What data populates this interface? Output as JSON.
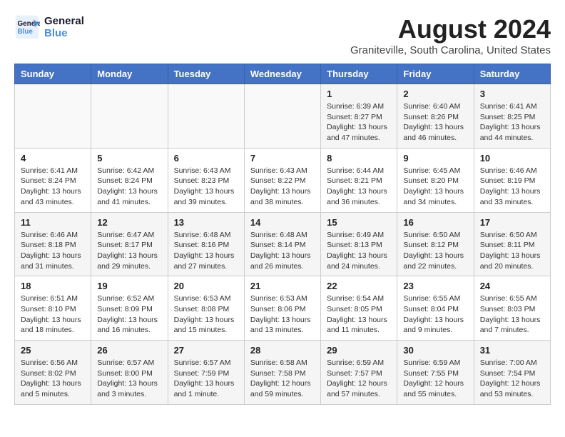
{
  "header": {
    "logo_line1": "General",
    "logo_line2": "Blue",
    "month_year": "August 2024",
    "location": "Graniteville, South Carolina, United States"
  },
  "weekdays": [
    "Sunday",
    "Monday",
    "Tuesday",
    "Wednesday",
    "Thursday",
    "Friday",
    "Saturday"
  ],
  "weeks": [
    [
      {
        "day": "",
        "info": ""
      },
      {
        "day": "",
        "info": ""
      },
      {
        "day": "",
        "info": ""
      },
      {
        "day": "",
        "info": ""
      },
      {
        "day": "1",
        "info": "Sunrise: 6:39 AM\nSunset: 8:27 PM\nDaylight: 13 hours\nand 47 minutes."
      },
      {
        "day": "2",
        "info": "Sunrise: 6:40 AM\nSunset: 8:26 PM\nDaylight: 13 hours\nand 46 minutes."
      },
      {
        "day": "3",
        "info": "Sunrise: 6:41 AM\nSunset: 8:25 PM\nDaylight: 13 hours\nand 44 minutes."
      }
    ],
    [
      {
        "day": "4",
        "info": "Sunrise: 6:41 AM\nSunset: 8:24 PM\nDaylight: 13 hours\nand 43 minutes."
      },
      {
        "day": "5",
        "info": "Sunrise: 6:42 AM\nSunset: 8:24 PM\nDaylight: 13 hours\nand 41 minutes."
      },
      {
        "day": "6",
        "info": "Sunrise: 6:43 AM\nSunset: 8:23 PM\nDaylight: 13 hours\nand 39 minutes."
      },
      {
        "day": "7",
        "info": "Sunrise: 6:43 AM\nSunset: 8:22 PM\nDaylight: 13 hours\nand 38 minutes."
      },
      {
        "day": "8",
        "info": "Sunrise: 6:44 AM\nSunset: 8:21 PM\nDaylight: 13 hours\nand 36 minutes."
      },
      {
        "day": "9",
        "info": "Sunrise: 6:45 AM\nSunset: 8:20 PM\nDaylight: 13 hours\nand 34 minutes."
      },
      {
        "day": "10",
        "info": "Sunrise: 6:46 AM\nSunset: 8:19 PM\nDaylight: 13 hours\nand 33 minutes."
      }
    ],
    [
      {
        "day": "11",
        "info": "Sunrise: 6:46 AM\nSunset: 8:18 PM\nDaylight: 13 hours\nand 31 minutes."
      },
      {
        "day": "12",
        "info": "Sunrise: 6:47 AM\nSunset: 8:17 PM\nDaylight: 13 hours\nand 29 minutes."
      },
      {
        "day": "13",
        "info": "Sunrise: 6:48 AM\nSunset: 8:16 PM\nDaylight: 13 hours\nand 27 minutes."
      },
      {
        "day": "14",
        "info": "Sunrise: 6:48 AM\nSunset: 8:14 PM\nDaylight: 13 hours\nand 26 minutes."
      },
      {
        "day": "15",
        "info": "Sunrise: 6:49 AM\nSunset: 8:13 PM\nDaylight: 13 hours\nand 24 minutes."
      },
      {
        "day": "16",
        "info": "Sunrise: 6:50 AM\nSunset: 8:12 PM\nDaylight: 13 hours\nand 22 minutes."
      },
      {
        "day": "17",
        "info": "Sunrise: 6:50 AM\nSunset: 8:11 PM\nDaylight: 13 hours\nand 20 minutes."
      }
    ],
    [
      {
        "day": "18",
        "info": "Sunrise: 6:51 AM\nSunset: 8:10 PM\nDaylight: 13 hours\nand 18 minutes."
      },
      {
        "day": "19",
        "info": "Sunrise: 6:52 AM\nSunset: 8:09 PM\nDaylight: 13 hours\nand 16 minutes."
      },
      {
        "day": "20",
        "info": "Sunrise: 6:53 AM\nSunset: 8:08 PM\nDaylight: 13 hours\nand 15 minutes."
      },
      {
        "day": "21",
        "info": "Sunrise: 6:53 AM\nSunset: 8:06 PM\nDaylight: 13 hours\nand 13 minutes."
      },
      {
        "day": "22",
        "info": "Sunrise: 6:54 AM\nSunset: 8:05 PM\nDaylight: 13 hours\nand 11 minutes."
      },
      {
        "day": "23",
        "info": "Sunrise: 6:55 AM\nSunset: 8:04 PM\nDaylight: 13 hours\nand 9 minutes."
      },
      {
        "day": "24",
        "info": "Sunrise: 6:55 AM\nSunset: 8:03 PM\nDaylight: 13 hours\nand 7 minutes."
      }
    ],
    [
      {
        "day": "25",
        "info": "Sunrise: 6:56 AM\nSunset: 8:02 PM\nDaylight: 13 hours\nand 5 minutes."
      },
      {
        "day": "26",
        "info": "Sunrise: 6:57 AM\nSunset: 8:00 PM\nDaylight: 13 hours\nand 3 minutes."
      },
      {
        "day": "27",
        "info": "Sunrise: 6:57 AM\nSunset: 7:59 PM\nDaylight: 13 hours\nand 1 minute."
      },
      {
        "day": "28",
        "info": "Sunrise: 6:58 AM\nSunset: 7:58 PM\nDaylight: 12 hours\nand 59 minutes."
      },
      {
        "day": "29",
        "info": "Sunrise: 6:59 AM\nSunset: 7:57 PM\nDaylight: 12 hours\nand 57 minutes."
      },
      {
        "day": "30",
        "info": "Sunrise: 6:59 AM\nSunset: 7:55 PM\nDaylight: 12 hours\nand 55 minutes."
      },
      {
        "day": "31",
        "info": "Sunrise: 7:00 AM\nSunset: 7:54 PM\nDaylight: 12 hours\nand 53 minutes."
      }
    ]
  ]
}
